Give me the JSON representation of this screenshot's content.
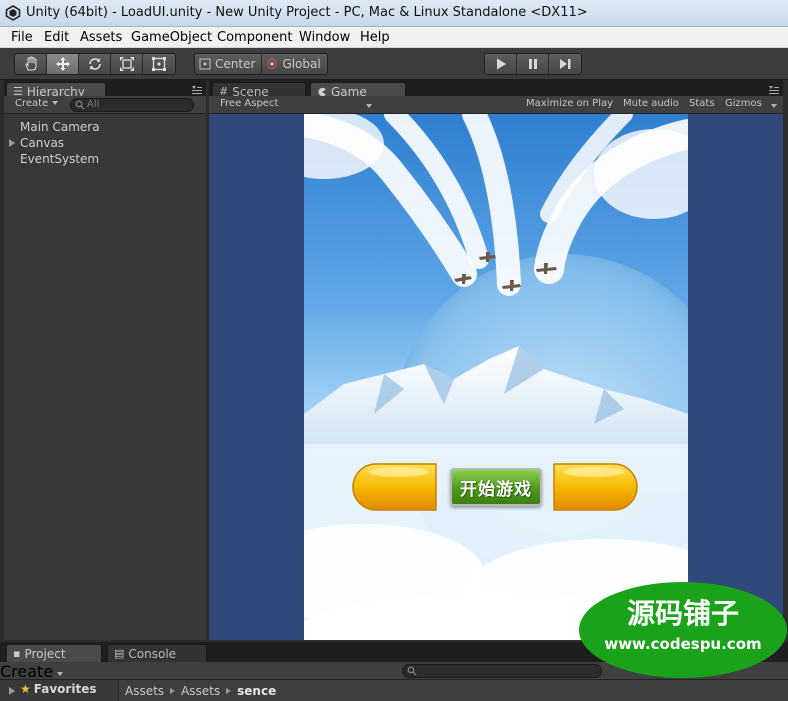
{
  "window": {
    "title": "Unity (64bit) - LoadUI.unity - New Unity Project - PC, Mac & Linux Standalone <DX11>"
  },
  "menu": [
    "File",
    "Edit",
    "Assets",
    "GameObject",
    "Component",
    "Window",
    "Help"
  ],
  "toolbar": {
    "tools": [
      "hand-icon",
      "move-icon",
      "rotate-icon",
      "scale-icon",
      "rect-tool-icon"
    ],
    "pivot_label": "Center",
    "space_label": "Global",
    "play_controls": [
      "play-icon",
      "pause-icon",
      "step-icon"
    ]
  },
  "hierarchy": {
    "tab_label": "Hierarchy",
    "create_label": "Create",
    "search_placeholder": "All",
    "items": [
      {
        "label": "Main Camera",
        "expandable": false
      },
      {
        "label": "Canvas",
        "expandable": true
      },
      {
        "label": "EventSystem",
        "expandable": false
      }
    ]
  },
  "center_tabs": [
    {
      "label": "Scene",
      "icon": "grid-icon",
      "active": false
    },
    {
      "label": "Game",
      "icon": "pacman-icon",
      "active": true
    }
  ],
  "game_view": {
    "aspect_label": "Free Aspect",
    "options": [
      "Maximize on Play",
      "Mute audio",
      "Stats",
      "Gizmos"
    ],
    "start_button_label": "开始游戏"
  },
  "bottom": {
    "tabs": [
      {
        "label": "Project",
        "icon": "folder-icon",
        "active": true
      },
      {
        "label": "Console",
        "icon": "console-icon",
        "active": false
      }
    ],
    "create_label": "Create",
    "favorites_label": "Favorites",
    "breadcrumb": [
      "Assets",
      "Assets",
      "sence"
    ]
  },
  "watermark": {
    "line1": "源码铺子",
    "line2": "www.codespu.com"
  },
  "colors": {
    "editor_dark": "#383838",
    "game_bg": "#30487a",
    "start_green": "#4f9a1f",
    "yellow_button": "#f7b800",
    "watermark_green": "#1aa31a"
  }
}
